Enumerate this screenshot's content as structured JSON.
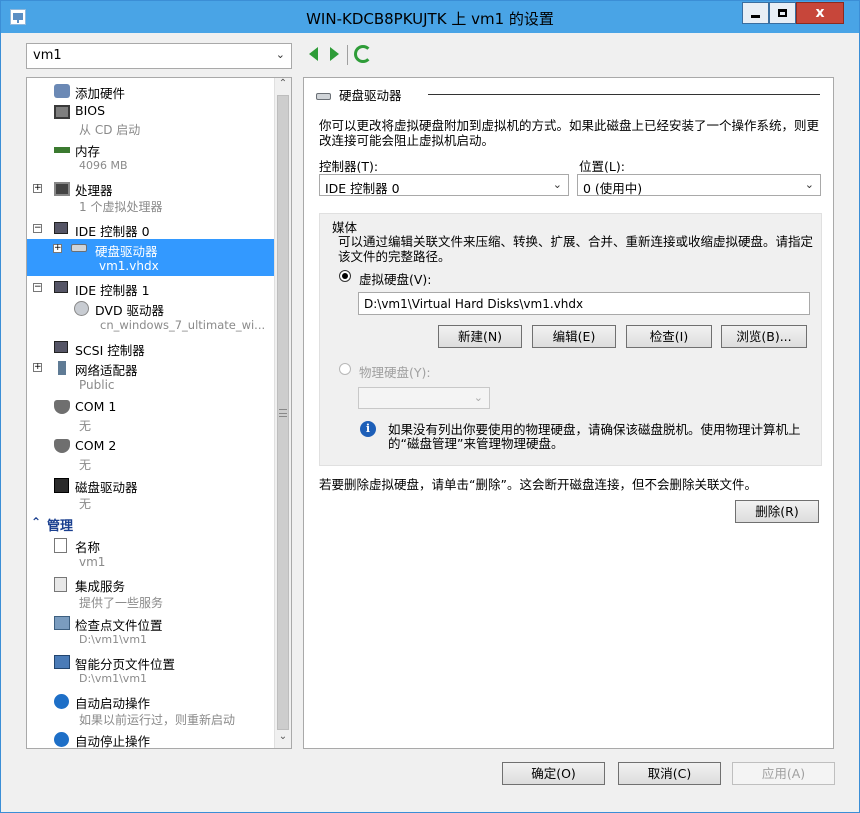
{
  "window": {
    "title": "WIN-KDCB8PKUJTK 上 vm1 的设置",
    "minimize": "minimize",
    "maximize": "maximize",
    "close": "x"
  },
  "vm_selector": {
    "value": "vm1"
  },
  "tree": {
    "items": [
      {
        "name": "添加硬件",
        "sub": ""
      },
      {
        "name": "BIOS",
        "sub": "从 CD 启动"
      },
      {
        "name": "内存",
        "sub": "4096 MB"
      },
      {
        "name": "处理器",
        "sub": "1 个虚拟处理器"
      },
      {
        "name": "IDE 控制器 0",
        "sub": ""
      },
      {
        "name": "硬盘驱动器",
        "sub": "vm1.vhdx"
      },
      {
        "name": "IDE 控制器 1",
        "sub": ""
      },
      {
        "name": "DVD 驱动器",
        "sub": "cn_windows_7_ultimate_wi..."
      },
      {
        "name": "SCSI 控制器",
        "sub": ""
      },
      {
        "name": "网络适配器",
        "sub": "Public"
      },
      {
        "name": "COM 1",
        "sub": "无"
      },
      {
        "name": "COM 2",
        "sub": "无"
      },
      {
        "name": "磁盘驱动器",
        "sub": "无"
      }
    ],
    "management_header": "管理",
    "management": [
      {
        "name": "名称",
        "sub": "vm1"
      },
      {
        "name": "集成服务",
        "sub": "提供了一些服务"
      },
      {
        "name": "检查点文件位置",
        "sub": "D:\\vm1\\vm1"
      },
      {
        "name": "智能分页文件位置",
        "sub": "D:\\vm1\\vm1"
      },
      {
        "name": "自动启动操作",
        "sub": "如果以前运行过，则重新启动"
      },
      {
        "name": "自动停止操作",
        "sub": ""
      }
    ]
  },
  "panel": {
    "heading": "硬盘驱动器",
    "description": "你可以更改将虚拟硬盘附加到虚拟机的方式。如果此磁盘上已经安装了一个操作系统，则更改连接可能会阻止虚拟机启动。",
    "controller_label": "控制器(T):",
    "controller_value": "IDE 控制器 0",
    "location_label": "位置(L):",
    "location_value": "0 (使用中)",
    "media_title": "媒体",
    "media_desc": "可以通过编辑关联文件来压缩、转换、扩展、合并、重新连接或收缩虚拟硬盘。请指定该文件的完整路径。",
    "vhd_radio_label": "虚拟硬盘(V):",
    "vhd_path": "D:\\vm1\\Virtual Hard Disks\\vm1.vhdx",
    "btn_new": "新建(N)",
    "btn_edit": "编辑(E)",
    "btn_inspect": "检查(I)",
    "btn_browse": "浏览(B)...",
    "physical_radio_label": "物理硬盘(Y):",
    "physical_value": "",
    "info_text": "如果没有列出你要使用的物理硬盘，请确保该磁盘脱机。使用物理计算机上的“磁盘管理”来管理物理硬盘。",
    "remove_desc": "若要删除虚拟硬盘，请单击“删除”。这会断开磁盘连接，但不会删除关联文件。",
    "btn_remove": "删除(R)"
  },
  "footer": {
    "ok": "确定(O)",
    "cancel": "取消(C)",
    "apply": "应用(A)"
  },
  "colors": {
    "titlebar": "#49a4e6",
    "selection": "#3399ff",
    "nav_green": "#2e9c38",
    "close_red": "#c7463a"
  }
}
